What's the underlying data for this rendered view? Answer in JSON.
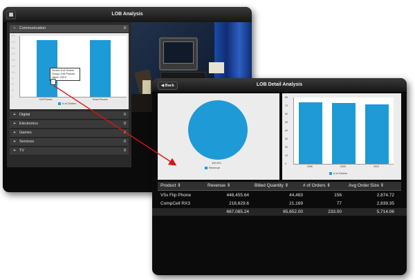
{
  "lob": {
    "title": "LOB Analysis",
    "menu_icon": "grid-icon",
    "expanded": {
      "label": "Communication",
      "count": "0"
    },
    "chart_data": {
      "type": "bar",
      "categories": [
        "Cell Phones",
        "Smart Phones"
      ],
      "values": [
        233,
        233
      ],
      "ylim": [
        0,
        250
      ],
      "yticks": [
        "250",
        "225",
        "200",
        "175",
        "150",
        "125",
        "100",
        "75",
        "50",
        "25",
        "0"
      ],
      "legend": "# of Orders",
      "colors": {
        "bar": "#1e9ad6"
      }
    },
    "tooltip": [
      "Series: # of Orders",
      "Group: Cell Phones",
      "Value: 233.0"
    ],
    "categories": [
      {
        "label": "Digital",
        "count": "0"
      },
      {
        "label": "Electronics",
        "count": "0"
      },
      {
        "label": "Games",
        "count": "0"
      },
      {
        "label": "Services",
        "count": "0"
      },
      {
        "label": "TV",
        "count": "0"
      }
    ]
  },
  "detail": {
    "title": "LOB Detail Analysis",
    "back_label": "Back",
    "pie": {
      "percent_label": "100.0%",
      "legend": "Revenue",
      "color": "#1e9ad6"
    },
    "chart_data": {
      "type": "bar",
      "categories": [
        "2008",
        "2009",
        "2010"
      ],
      "values": [
        74,
        73,
        72
      ],
      "ylim": [
        0,
        80
      ],
      "yticks": [
        "80",
        "70",
        "60",
        "50",
        "40",
        "30",
        "20",
        "10",
        "0"
      ],
      "legend": "# of Orders",
      "colors": {
        "bar": "#1e9ad6"
      }
    },
    "table": {
      "headers": [
        "Product ⇕",
        "Revenue ⇕",
        "Billed Quantity ⇕",
        "# of Orders ⇕",
        "Avg Order Size ⇕"
      ],
      "rows": [
        [
          "V5x Flip Phone",
          "448,455.64",
          "44,483",
          "156",
          "2,874.72"
        ],
        [
          "CompCell RX3",
          "218,629.6",
          "21,169",
          "77",
          "2,839.35"
        ],
        [
          "",
          "667,085.24",
          "65,652.00",
          "233.00",
          "5,714.06"
        ]
      ]
    }
  }
}
